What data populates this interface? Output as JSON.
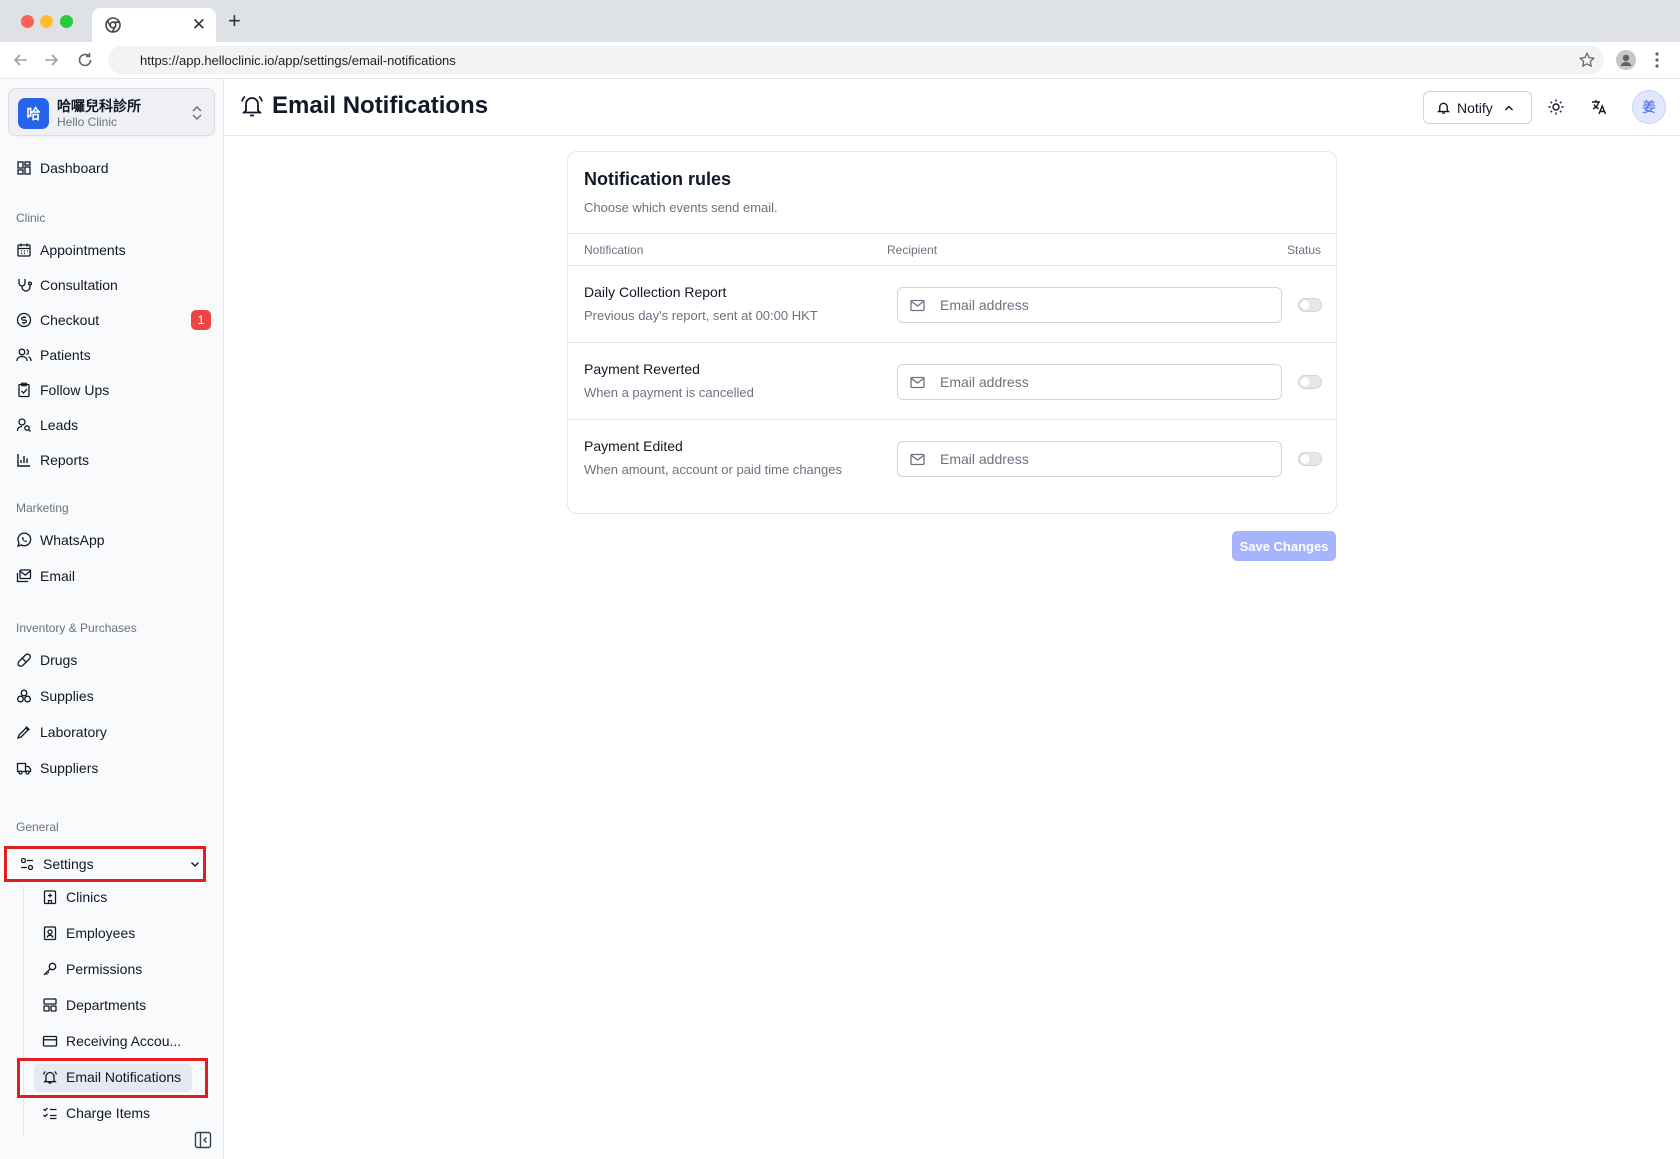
{
  "browser": {
    "url": "https://app.helloclinic.io/app/settings/email-notifications"
  },
  "clinic": {
    "logo_char": "哈",
    "name": "哈囉兒科診所",
    "subtitle": "Hello Clinic"
  },
  "sidebar": {
    "dashboard": "Dashboard",
    "sections": {
      "clinic": "Clinic",
      "marketing": "Marketing",
      "inventory": "Inventory & Purchases",
      "general": "General"
    },
    "clinic_items": {
      "appointments": "Appointments",
      "consultation": "Consultation",
      "checkout": "Checkout",
      "checkout_badge": "1",
      "patients": "Patients",
      "follow_ups": "Follow Ups",
      "leads": "Leads",
      "reports": "Reports"
    },
    "marketing_items": {
      "whatsapp": "WhatsApp",
      "email": "Email"
    },
    "inventory_items": {
      "drugs": "Drugs",
      "supplies": "Supplies",
      "laboratory": "Laboratory",
      "suppliers": "Suppliers"
    },
    "settings": {
      "label": "Settings",
      "sub": {
        "clinics": "Clinics",
        "employees": "Employees",
        "permissions": "Permissions",
        "departments": "Departments",
        "receiving_accounts": "Receiving Accou...",
        "email_notifications": "Email Notifications",
        "charge_items": "Charge Items"
      }
    }
  },
  "header": {
    "title": "Email Notifications",
    "notify_label": "Notify",
    "avatar_char": "姜"
  },
  "card": {
    "title": "Notification rules",
    "subtitle": "Choose which events send email.",
    "columns": {
      "notification": "Notification",
      "recipient": "Recipient",
      "status": "Status"
    },
    "rows": [
      {
        "title": "Daily Collection Report",
        "desc": "Previous day's report, sent at 00:00 HKT",
        "placeholder": "Email address",
        "enabled": false
      },
      {
        "title": "Payment Reverted",
        "desc": "When a payment is cancelled",
        "placeholder": "Email address",
        "enabled": false
      },
      {
        "title": "Payment Edited",
        "desc": "When amount, account or paid time changes",
        "placeholder": "Email address",
        "enabled": false
      }
    ]
  },
  "save_button": "Save Changes"
}
